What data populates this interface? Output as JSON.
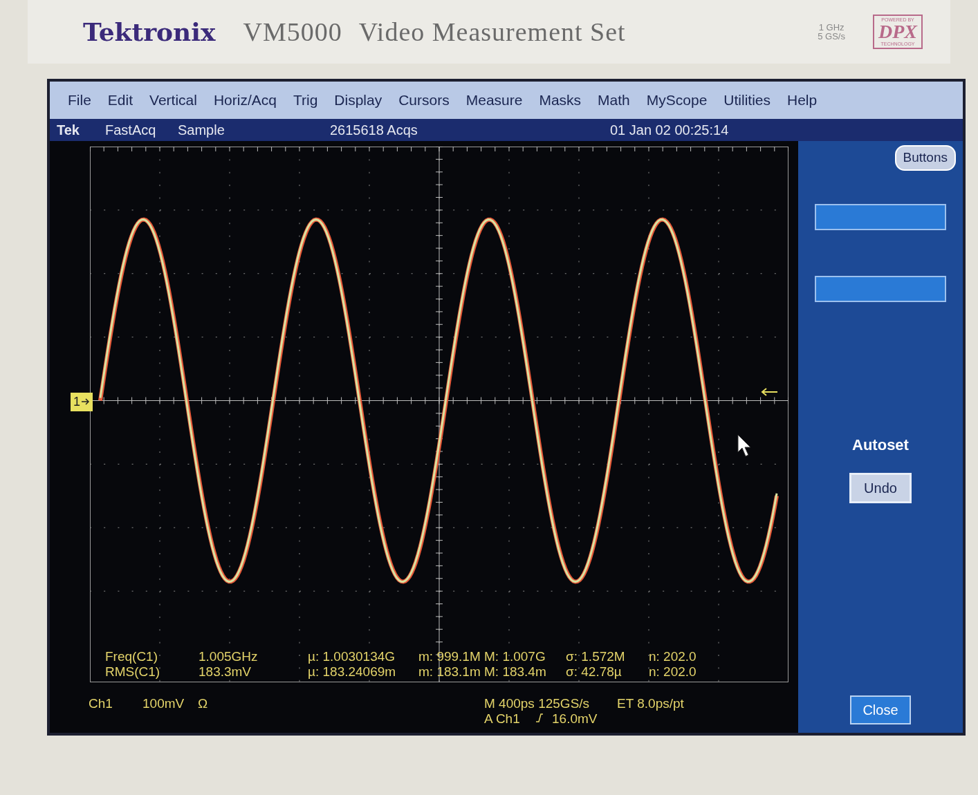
{
  "header": {
    "brand": "Tektronix",
    "model": "VM5000",
    "title": "Video Measurement Set",
    "spec_lines": [
      "1 GHz",
      "5 GS/s"
    ],
    "badge": {
      "top": "POWERED BY",
      "main": "DPX",
      "bottom": "TECHNOLOGY"
    }
  },
  "menu": [
    "File",
    "Edit",
    "Vertical",
    "Horiz/Acq",
    "Trig",
    "Display",
    "Cursors",
    "Measure",
    "Masks",
    "Math",
    "MyScope",
    "Utilities",
    "Help"
  ],
  "status_bar": {
    "brand": "Tek",
    "mode": "FastAcq",
    "acquisition": "Sample",
    "acqs": "2615618 Acqs",
    "datetime": "01 Jan 02 00:25:14"
  },
  "graticule": {
    "channel_marker": "1"
  },
  "measurements": [
    {
      "label": "Freq(C1)",
      "value": "1.005GHz",
      "stats": [
        "µ: 1.0030134G",
        "m: 999.1M",
        "M: 1.007G",
        "σ: 1.572M",
        "n: 202.0"
      ]
    },
    {
      "label": "RMS(C1)",
      "value": "183.3mV",
      "stats": [
        "µ: 183.24069m",
        "m: 183.1m",
        "M: 183.4m",
        "σ: 42.78µ",
        "n: 202.0"
      ]
    }
  ],
  "readouts": {
    "channel": "Ch1",
    "scale": "100mV",
    "coupling": "Ω",
    "timebase": "M 400ps 125GS/s",
    "sampling": "ET 8.0ps/pt",
    "trigger_source": "A Ch1",
    "trigger_level": "16.0mV"
  },
  "side_panel": {
    "tab": "Buttons",
    "heading": "Autoset",
    "buttons": [
      "Undo"
    ],
    "close": "Close"
  }
}
